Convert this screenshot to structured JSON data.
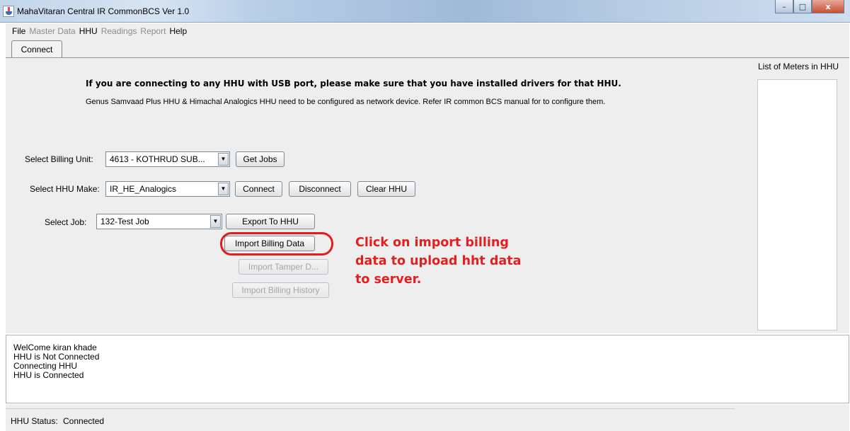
{
  "window": {
    "title": "MahaVitaran Central IR CommonBCS Ver 1.0",
    "controls": [
      "–",
      "□",
      "x"
    ]
  },
  "menu": [
    {
      "label": "File",
      "enabled": true
    },
    {
      "label": "Master Data",
      "enabled": false
    },
    {
      "label": "HHU",
      "enabled": true
    },
    {
      "label": "Readings",
      "enabled": false
    },
    {
      "label": "Report",
      "enabled": false
    },
    {
      "label": "Help",
      "enabled": true
    }
  ],
  "tabs": [
    {
      "label": "Connect",
      "active": true
    }
  ],
  "meters_panel": {
    "title": "List of Meters in HHU"
  },
  "notices": {
    "usb": "If you are connecting to any HHU with USB port, please make sure that you have installed drivers for that HHU.",
    "network": "Genus Samvaad Plus HHU & Himachal Analogics HHU need to be configured as network device. Refer IR common BCS manual for to configure them."
  },
  "form": {
    "billing_unit": {
      "label": "Select Billing Unit:",
      "value": "4613 - KOTHRUD SUB..."
    },
    "hhu_make": {
      "label": "Select HHU Make:",
      "value": "IR_HE_Analogics"
    },
    "job": {
      "label": "Select Job:",
      "value": "132-Test Job"
    }
  },
  "buttons": {
    "get_jobs": "Get Jobs",
    "connect": "Connect",
    "disconnect": "Disconnect",
    "clear_hhu": "Clear HHU",
    "export_to_hhu": "Export To HHU",
    "import_billing_data": "Import Billing Data",
    "import_tamper_data": "Import Tamper D...",
    "import_billing_history": "Import Billing History"
  },
  "annotation": {
    "lines": [
      "Click on import billing",
      "data to upload hht data",
      "to server."
    ],
    "color": "#e0211f"
  },
  "log": [
    "WelCome kiran khade",
    "HHU is Not Connected",
    "Connecting HHU",
    "HHU is Connected"
  ],
  "status": {
    "label": "HHU Status:",
    "value": "Connected"
  },
  "icons": {
    "combo_arrow": "▼"
  }
}
